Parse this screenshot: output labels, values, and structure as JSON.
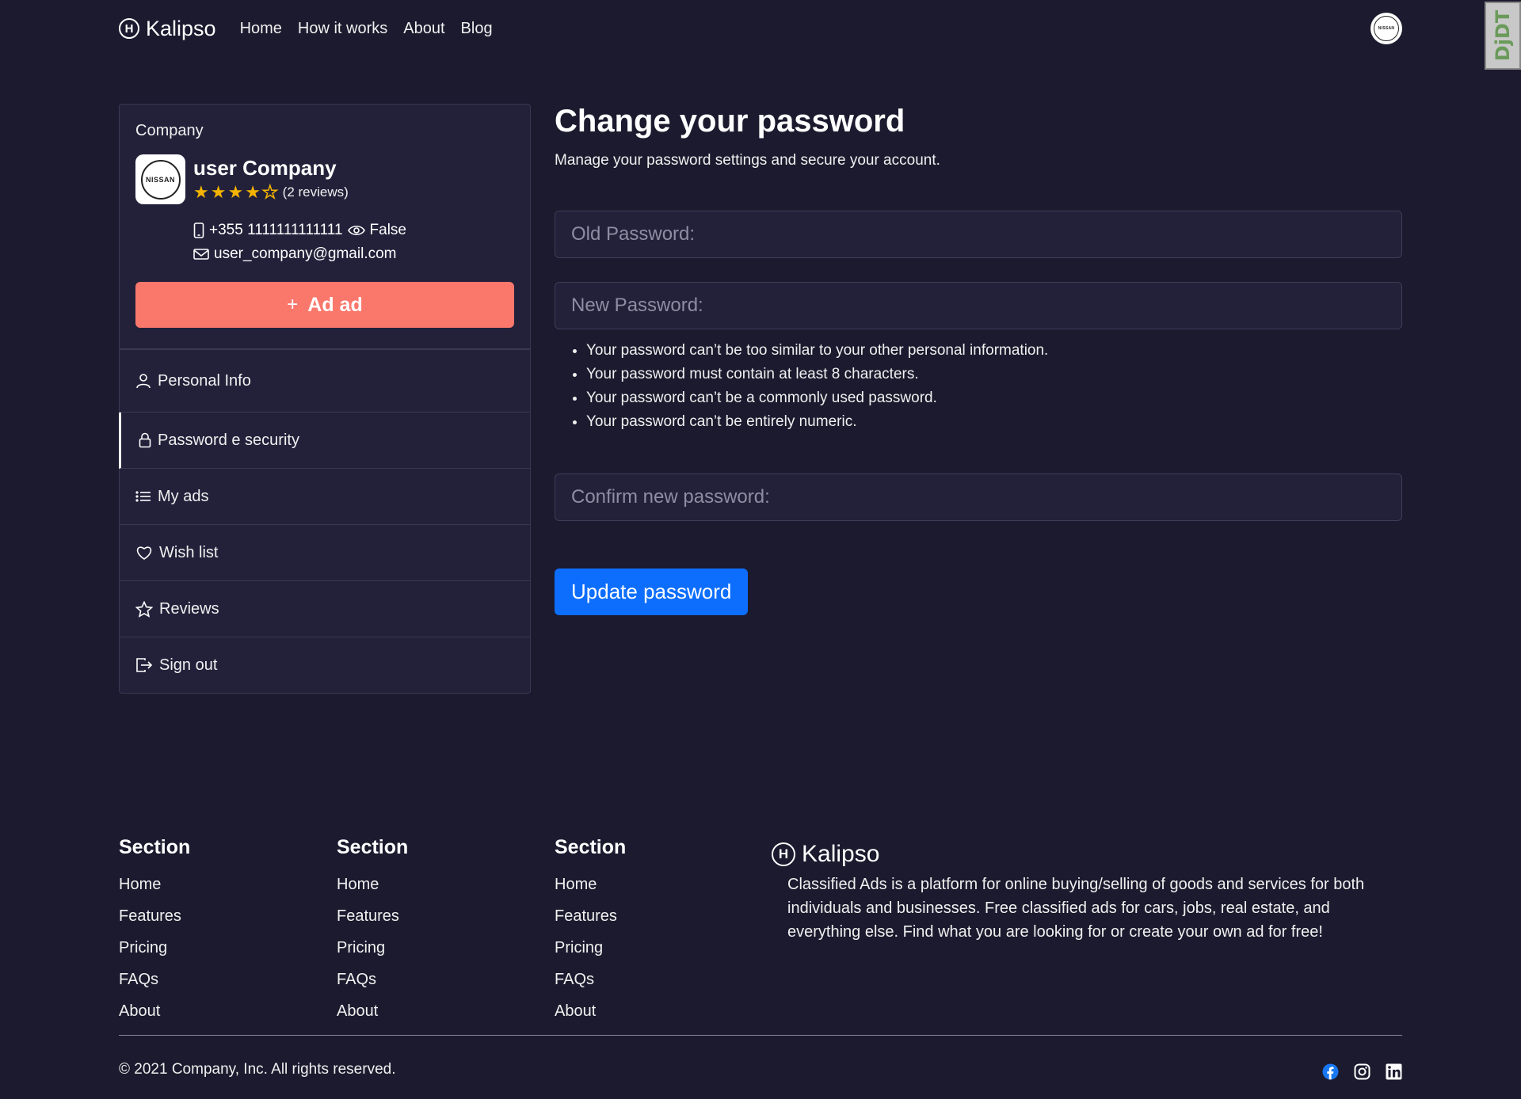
{
  "navbar": {
    "brand": "Kalipso",
    "brand_icon": "H",
    "links": [
      "Home",
      "How it works",
      "About",
      "Blog"
    ],
    "avatar_text": "NISSAN",
    "corner_badge": "DjDT"
  },
  "company": {
    "caption": "Company",
    "logo_text": "NISSAN",
    "name": "user Company",
    "rating": 4,
    "rating_max": 5,
    "reviews": "(2 reviews)",
    "phone": "+355 1111111111111",
    "visibility": "False",
    "email": "user_company@gmail.com",
    "ad_button_plus": "+",
    "ad_button": "Ad ad"
  },
  "menu": {
    "personal_info": "Personal Info",
    "password_security": "Password e security",
    "my_ads": "My ads",
    "wish_list": "Wish list",
    "reviews": "Reviews",
    "sign_out": "Sign out"
  },
  "main": {
    "title": "Change your password",
    "subtitle": "Manage your password settings and secure your account.",
    "old_password_placeholder": "Old Password:",
    "new_password_placeholder": "New Password:",
    "rules": [
      "Your password can’t be too similar to your other personal information.",
      "Your password must contain at least 8 characters.",
      "Your password can’t be a commonly used password.",
      "Your password can’t be entirely numeric."
    ],
    "confirm_password_placeholder": "Confirm new password:",
    "submit": "Update password"
  },
  "footer": {
    "columns": [
      {
        "title": "Section",
        "links": [
          "Home",
          "Features",
          "Pricing",
          "FAQs",
          "About"
        ]
      },
      {
        "title": "Section",
        "links": [
          "Home",
          "Features",
          "Pricing",
          "FAQs",
          "About"
        ]
      },
      {
        "title": "Section",
        "links": [
          "Home",
          "Features",
          "Pricing",
          "FAQs",
          "About"
        ]
      }
    ],
    "brand": "Kalipso",
    "description": "Classified Ads is a platform for online buying/selling of goods and services for both individuals and businesses. Free classified ads for cars, jobs, real estate, and everything else. Find what you are looking for or create your own ad for free!",
    "copyright": "© 2021 Company, Inc. All rights reserved.",
    "socials": [
      "facebook-icon",
      "instagram-icon",
      "linkedin-icon"
    ]
  },
  "colors": {
    "background": "#1c1a2e",
    "card": "#23213a",
    "accent_coral": "#fa776c",
    "primary_blue": "#0d6efd",
    "star": "#f5b400"
  }
}
